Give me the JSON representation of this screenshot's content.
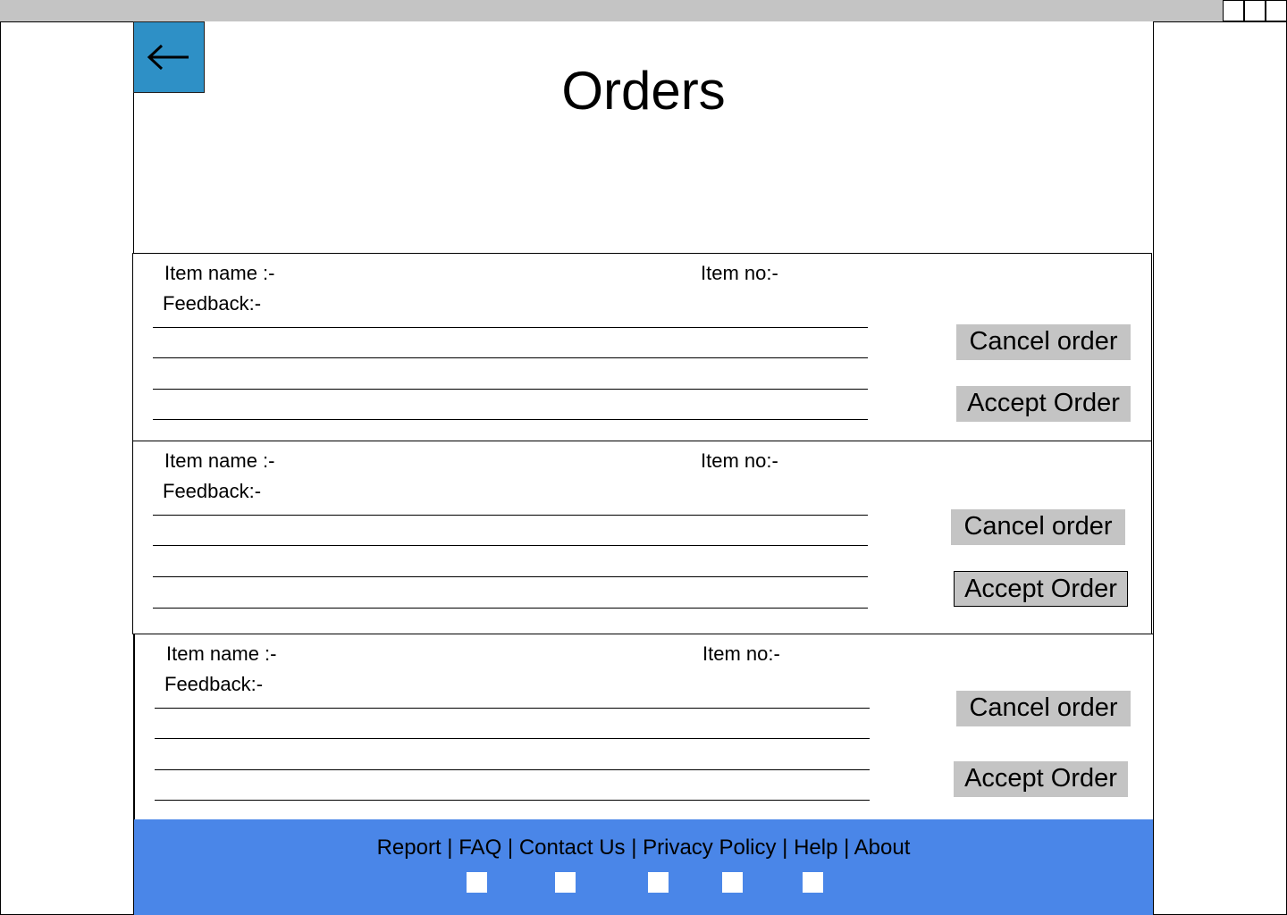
{
  "page": {
    "title": "Orders"
  },
  "header": {
    "back_icon": "arrow-left-icon",
    "accent": "#2e90c6"
  },
  "orders": [
    {
      "item_name_label": "Item name :-",
      "item_no_label": "Item no:-",
      "feedback_label": "Feedback:-",
      "cancel_label": "Cancel order",
      "accept_label": "Accept Order"
    },
    {
      "item_name_label": "Item name :-",
      "item_no_label": "Item no:-",
      "feedback_label": "Feedback:-",
      "cancel_label": "Cancel order",
      "accept_label": "Accept Order"
    },
    {
      "item_name_label": "Item name :-",
      "item_no_label": "Item no:-",
      "feedback_label": "Feedback:-",
      "cancel_label": "Cancel order",
      "accept_label": "Accept Order"
    }
  ],
  "footer": {
    "background": "#4a86e8",
    "links": [
      "Report",
      "FAQ",
      "Contact Us",
      "Privacy Policy",
      "Help",
      "About"
    ],
    "separator": " | ",
    "social_icons": [
      "social-icon-1",
      "social-icon-2",
      "social-icon-3",
      "social-icon-4",
      "social-icon-5"
    ]
  }
}
